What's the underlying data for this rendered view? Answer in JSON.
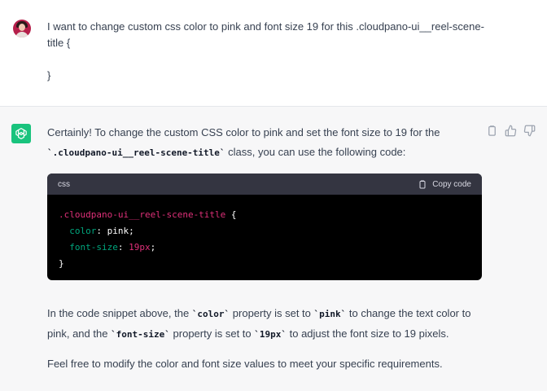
{
  "user_message": {
    "text": "I want to change custom css color to pink and font size 19 for this .cloudpano-ui__reel-scene-\ntitle {\n\n}"
  },
  "assistant": {
    "intro_1": "Certainly! To change the custom CSS color to pink and set the font size to 19 for the",
    "intro_code": "`.cloudpano-ui__reel-scene-title`",
    "intro_2": " class, you can use the following code:",
    "code_block": {
      "language": "css",
      "copy_label": "Copy code",
      "line1_selector": ".cloudpano-ui__reel-scene-title",
      "line1_brace": " {",
      "line2_indent": "  ",
      "line2_prop": "color",
      "line2_colon": ": ",
      "line2_value": "pink",
      "line2_semi": ";",
      "line3_indent": "  ",
      "line3_prop": "font-size",
      "line3_colon": ": ",
      "line3_value": "19px",
      "line3_semi": ";",
      "line4": "}"
    },
    "explain_1": "In the code snippet above, the ",
    "explain_code1": "`color`",
    "explain_2": " property is set to ",
    "explain_code2": "`pink`",
    "explain_3": " to change the text color to pink, and the ",
    "explain_code3": "`font-size`",
    "explain_4": " property is set to ",
    "explain_code4": "`19px`",
    "explain_5": " to adjust the font size to 19 pixels.",
    "closing": "Feel free to modify the color and font size values to meet your specific requirements."
  },
  "icons": {
    "user_avatar": "user-avatar",
    "assistant_logo": "openai-logo-icon",
    "copy": "clipboard-icon",
    "thumbs_up": "thumbs-up-icon",
    "thumbs_down": "thumbs-down-icon"
  },
  "colors": {
    "assistant_icon_bg": "#19c37d",
    "code_bg": "#000000",
    "code_header_bg": "#343541",
    "selector": "#df3079",
    "property": "#00a67d"
  }
}
